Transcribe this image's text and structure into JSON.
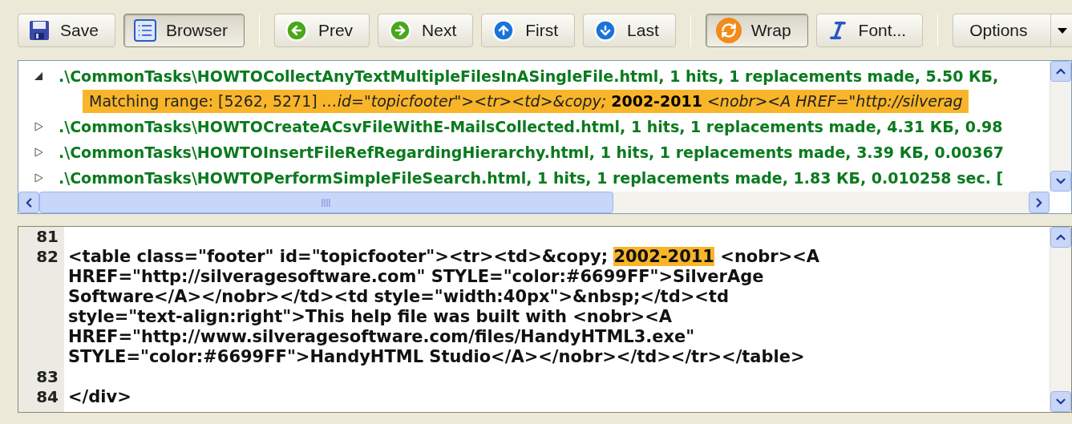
{
  "toolbar": {
    "groups": [
      [
        {
          "label": "Save",
          "pressed": false
        },
        {
          "label": "Browser",
          "pressed": true
        }
      ],
      [
        {
          "label": "Prev",
          "pressed": false
        },
        {
          "label": "Next",
          "pressed": false
        },
        {
          "label": "First",
          "pressed": false
        },
        {
          "label": "Last",
          "pressed": false
        }
      ],
      [
        {
          "label": "Wrap",
          "pressed": true
        },
        {
          "label": "Font...",
          "pressed": false
        }
      ],
      [
        {
          "label": "Options",
          "pressed": false,
          "has_menu": true
        }
      ]
    ]
  },
  "results": {
    "items": [
      {
        "text": ".\\CommonTasks\\HOWTOCollectAnyTextMultipleFilesInASingleFile.html, 1 hits, 1 replacements made, 5.50 КБ,",
        "expanded": true,
        "children": [
          {
            "text": "Matching range: [5262, 5271] *…id=\"topicfooter\"><tr><td>&copy;* **2002-2011** *<nobr><A HREF=\"http://silverag*"
          }
        ]
      },
      {
        "text": ".\\CommonTasks\\HOWTOCreateACsvFileWithE-MailsCollected.html, 1 hits, 1 replacements made, 4.31 КБ, 0.98",
        "expanded": false
      },
      {
        "text": ".\\CommonTasks\\HOWTOInsertFileRefRegardingHierarchy.html, 1 hits, 1 replacements made, 3.39 КБ, 0.00367",
        "expanded": false
      },
      {
        "text": ".\\CommonTasks\\HOWTOPerformSimpleFileSearch.html, 1 hits, 1 replacements made, 1.83 КБ, 0.010258 sec. [",
        "expanded": false
      }
    ]
  },
  "editor": {
    "lines": [
      {
        "number": "81"
      },
      {
        "number": "82",
        "rows": [
          [
            {
              "text": "<table class=\"footer\" id=\"topicfooter\"><tr><td>&copy; ",
              "highlighted": false
            },
            {
              "text": "2002-2011",
              "highlighted": true
            },
            {
              "text": " <nobr><A",
              "highlighted": false
            }
          ],
          [
            {
              "text": "HREF=\"http://silveragesoftware.com\" STYLE=\"color:#6699FF\">SilverAge",
              "highlighted": false
            }
          ],
          [
            {
              "text": "Software</A></nobr></td><td style=\"width:40px\">&nbsp;</td><td",
              "highlighted": false
            }
          ],
          [
            {
              "text": "style=\"text-align:right\">This help file was built with <nobr><A",
              "highlighted": false
            }
          ],
          [
            {
              "text": "HREF=\"http://www.silveragesoftware.com/files/HandyHTML3.exe\"",
              "highlighted": false
            }
          ],
          [
            {
              "text": "STYLE=\"color:#6699FF\">HandyHTML Studio</A></nobr></td></tr></table>",
              "highlighted": false
            }
          ]
        ]
      },
      {
        "number": "83"
      },
      {
        "number": "84",
        "rows": [
          [
            {
              "text": "</div>",
              "highlighted": false
            }
          ]
        ]
      }
    ]
  }
}
